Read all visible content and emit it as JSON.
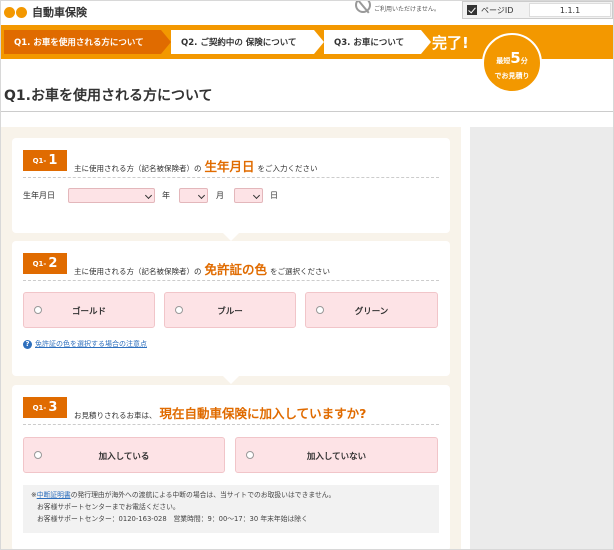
{
  "header": {
    "app_title": "自動車保険",
    "notice_text": "ご利用いただけません。",
    "page_id_label": "ページID",
    "page_id_value": "1.1.1"
  },
  "steps": [
    {
      "label": "Q1. お車を使用される方について",
      "state": "active"
    },
    {
      "label": "Q2. ご契約中の 保険について",
      "state": "inactive"
    },
    {
      "label": "Q3. お車について",
      "state": "inactive"
    }
  ],
  "done_label": "完了!",
  "badge": {
    "prefix": "最短",
    "number": "5",
    "unit": "分",
    "suffix": "でお見積り"
  },
  "page_title": "Q1.お車を使用される方について",
  "q1_1": {
    "num_prefix": "Q1-",
    "num": "1",
    "text_before": "主に使用される方（記名被保険者）の",
    "text_emphasis": "生年月日",
    "text_after": "をご入力ください",
    "field_label": "生年月日",
    "unit_year": "年",
    "unit_month": "月",
    "unit_day": "日"
  },
  "q1_2": {
    "num_prefix": "Q1-",
    "num": "2",
    "text_before": "主に使用される方（記名被保険者）の",
    "text_emphasis": "免許証の色",
    "text_after": "をご選択ください",
    "options": [
      "ゴールド",
      "ブルー",
      "グリーン"
    ],
    "help_link": "免許証の色を選択する場合の注意点"
  },
  "q1_3": {
    "num_prefix": "Q1-",
    "num": "3",
    "text_before": "お見積りされるお車は、",
    "text_emphasis": "現在自動車保険に加入していますか?",
    "options": [
      "加入している",
      "加入していない"
    ],
    "note_mark": "※",
    "note_link": "中断証明書",
    "note_line1": "の発行理由が海外への渡航による中断の場合は、当サイトでのお取扱いはできません。",
    "note_line2": "お客様サポートセンターまでお電話ください。",
    "note_line3": "お客様サポートセンター：0120-163-028　営業時間：9：00〜17：30 年末年始は除く"
  },
  "colors": {
    "brand_orange": "#f39800",
    "accent_orange": "#e06b00",
    "option_pink": "#fde3e6",
    "link_blue": "#2d6fbd"
  }
}
